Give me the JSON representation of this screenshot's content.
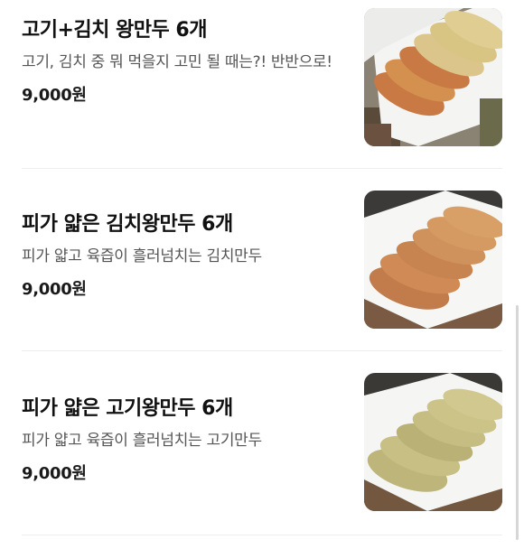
{
  "menu": {
    "items": [
      {
        "name": "고기+김치 왕만두 6개",
        "description": "고기, 김치 중 뭐 먹을지 고민 될 때는?! 반반으로!",
        "price": "9,000원",
        "image": "mixed-meat-kimchi-dumplings-photo"
      },
      {
        "name": "피가 얇은 김치왕만두 6개",
        "description": "피가 얇고 육즙이 흘러넘치는 김치만두",
        "price": "9,000원",
        "image": "kimchi-dumplings-photo"
      },
      {
        "name": "피가 얇은 고기왕만두 6개",
        "description": "피가 얇고 육즙이 흘러넘치는 고기만두",
        "price": "9,000원",
        "image": "meat-dumplings-photo"
      }
    ]
  },
  "colors": {
    "text": "#111111",
    "description": "#555555",
    "divider": "#eeeeee"
  }
}
